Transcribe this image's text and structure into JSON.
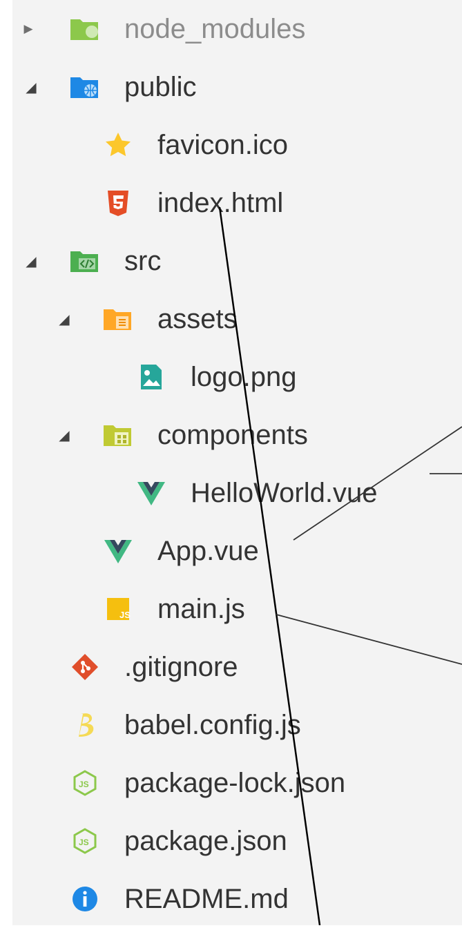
{
  "explorer": {
    "items": [
      {
        "label": "node_modules",
        "icon": "folder-node-icon",
        "arrow": "▶",
        "dim": true
      },
      {
        "label": "public",
        "icon": "folder-public-icon",
        "arrow": "◢"
      },
      {
        "label": "favicon.ico",
        "icon": "star-icon"
      },
      {
        "label": "index.html",
        "icon": "html5-icon"
      },
      {
        "label": "src",
        "icon": "folder-src-icon",
        "arrow": "◢"
      },
      {
        "label": "assets",
        "icon": "folder-assets-icon",
        "arrow": "◢"
      },
      {
        "label": "logo.png",
        "icon": "image-file-icon"
      },
      {
        "label": "components",
        "icon": "folder-components-icon",
        "arrow": "◢"
      },
      {
        "label": "HelloWorld.vue",
        "icon": "vue-icon"
      },
      {
        "label": "App.vue",
        "icon": "vue-icon"
      },
      {
        "label": "main.js",
        "icon": "js-icon"
      },
      {
        "label": ".gitignore",
        "icon": "git-icon"
      },
      {
        "label": "babel.config.js",
        "icon": "babel-icon"
      },
      {
        "label": "package-lock.json",
        "icon": "nodejs-icon"
      },
      {
        "label": "package.json",
        "icon": "nodejs-icon"
      },
      {
        "label": "README.md",
        "icon": "info-icon"
      }
    ]
  },
  "colors": {
    "panel_background": "#f3f3f3",
    "text": "#333333",
    "dim_text": "#8c8c8c",
    "vue_green": "#41b883",
    "vue_dark": "#35495e",
    "html_orange": "#e44d26",
    "js_yellow": "#f5bf0f",
    "git_red": "#e04e2b",
    "info_blue": "#1e88e5",
    "node_green": "#8cc84b"
  }
}
